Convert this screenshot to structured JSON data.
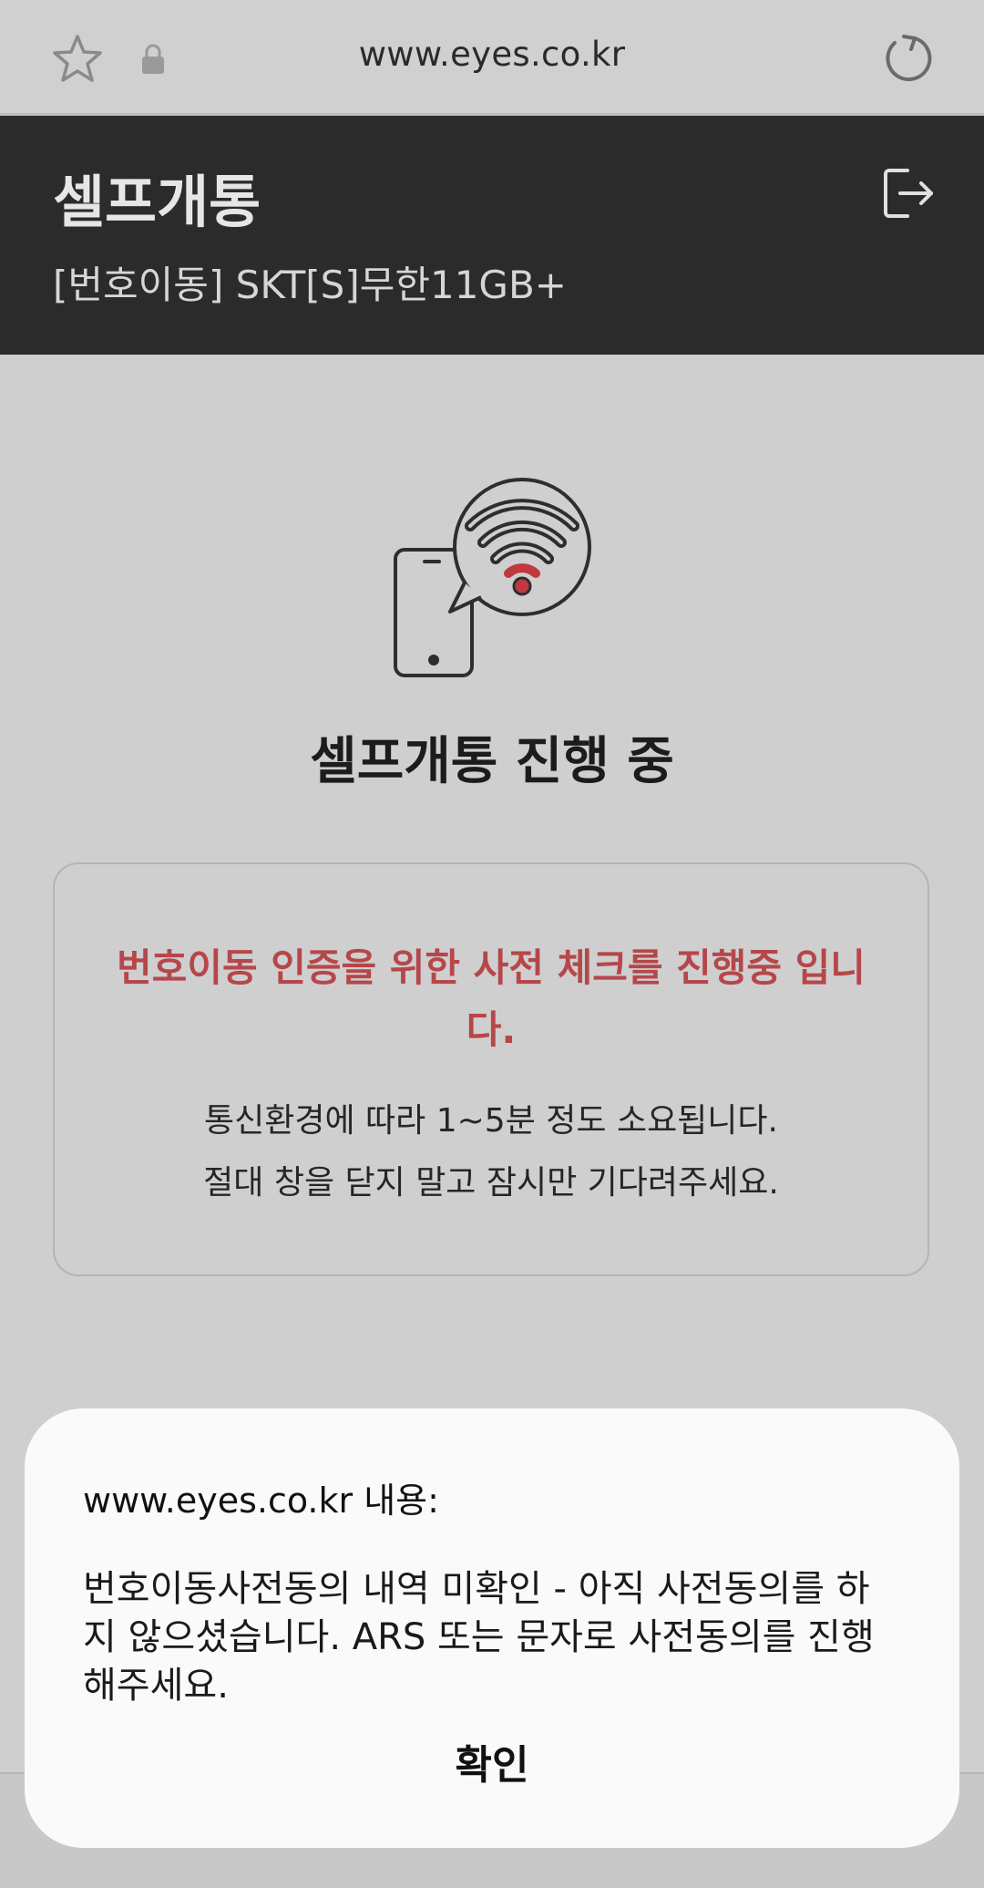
{
  "browser": {
    "url": "www.eyes.co.kr",
    "icons": [
      "star-icon",
      "lock-icon",
      "reload-icon"
    ]
  },
  "header": {
    "title": "셀프개통",
    "subtitle": "[번호이동] SKT[S]무한11GB+",
    "icon": "logout-icon",
    "background": "#2b2b2b"
  },
  "main": {
    "illustration": "phone-wifi-icon",
    "heading": "셀프개통 진행 중",
    "notice": {
      "warning": "번호이동 인증을 위한 사전 체크를 진행중 입니다.",
      "line1": "통신환경에 따라 1~5분 정도 소요됩니다.",
      "line2": "절대 창을 닫지 말고 잠시만 기다려주세요.",
      "warning_color": "#b5474a"
    }
  },
  "dialog": {
    "title": "www.eyes.co.kr 내용:",
    "message": "번호이동사전동의 내역 미확인 - 아직 사전동의를 하지 않으셨습니다. ARS 또는 문자로 사전동의를 진행해주세요.",
    "confirm_label": "확인"
  }
}
